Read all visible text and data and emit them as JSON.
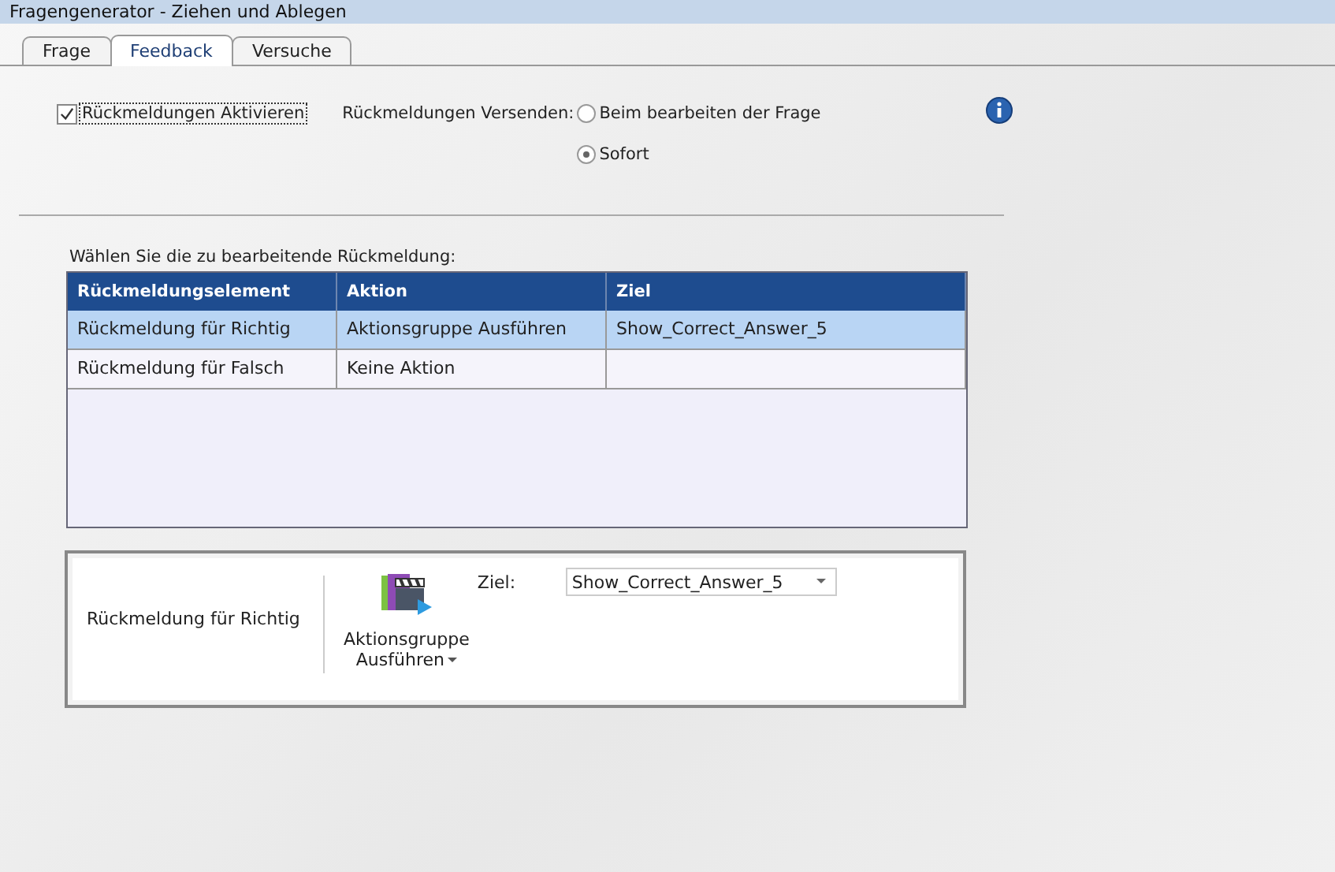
{
  "window": {
    "title": "Fragengenerator - Ziehen und Ablegen"
  },
  "tabs": [
    {
      "label": "Frage",
      "selected": false
    },
    {
      "label": "Feedback",
      "selected": true
    },
    {
      "label": "Versuche",
      "selected": false
    }
  ],
  "enable_feedback": {
    "label": "Rückmeldungen Aktivieren",
    "checked": true
  },
  "send_feedback": {
    "label": "Rückmeldungen Versenden:",
    "options": [
      {
        "label": "Beim bearbeiten der Frage",
        "selected": false
      },
      {
        "label": "Sofort",
        "selected": true
      }
    ]
  },
  "table": {
    "caption": "Wählen Sie die zu bearbeitende Rückmeldung:",
    "columns": [
      "Rückmeldungselement",
      "Aktion",
      "Ziel"
    ],
    "rows": [
      {
        "cells": [
          "Rückmeldung für Richtig",
          "Aktionsgruppe Ausführen",
          "Show_Correct_Answer_5"
        ],
        "selected": true
      },
      {
        "cells": [
          "Rückmeldung für Falsch",
          "Keine Aktion",
          ""
        ],
        "selected": false
      }
    ]
  },
  "detail": {
    "element": "Rückmeldung für Richtig",
    "action_button": {
      "line_1": "Aktionsgruppe",
      "line_2": "Ausführen"
    },
    "target_label": "Ziel:",
    "target_value": "Show_Correct_Answer_5"
  }
}
